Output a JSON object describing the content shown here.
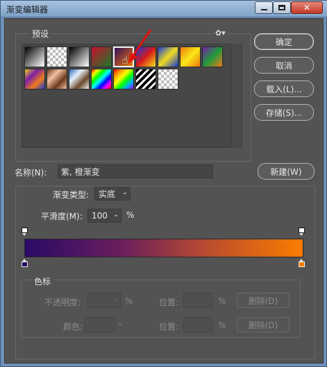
{
  "window": {
    "title": "渐变编辑器",
    "controls": {
      "minimize": "–",
      "maximize": "□",
      "close": "✕"
    }
  },
  "presets": {
    "label": "预设",
    "menu_icon": "gear-icon",
    "swatches_row1": [
      {
        "name": "foreground-to-background",
        "css": "linear-gradient(135deg,#000,#fff)"
      },
      {
        "name": "foreground-to-transparent",
        "css": "linear-gradient(135deg,#000 10%,rgba(0,0,0,0) 80%)"
      },
      {
        "name": "black-white",
        "css": "linear-gradient(135deg,#000,#fff)"
      },
      {
        "name": "red-green",
        "css": "linear-gradient(135deg,#c8102e,#1b7a2a)"
      },
      {
        "name": "violet-orange",
        "css": "linear-gradient(135deg,#2b0a63,#f97b00)"
      },
      {
        "name": "blue-red-yellow",
        "css": "linear-gradient(135deg,#1a3ad8,#d81a1a,#f2e21a)"
      },
      {
        "name": "blue-yellow-blue",
        "css": "linear-gradient(135deg,#1a3ad8,#f0dc20,#1a3ad8)"
      },
      {
        "name": "orange-yellow-orange",
        "css": "linear-gradient(135deg,#f0780a,#f8e81a,#f0780a)"
      },
      {
        "name": "violet-green-orange",
        "css": "linear-gradient(135deg,#7a1fa8,#1f9a3a,#f07a1a)"
      }
    ],
    "swatches_row2": [
      {
        "name": "yellow-violet-orange-blue",
        "css": "linear-gradient(135deg,#f2d21a,#7a1fa8,#f07a1a,#1a3ad8)"
      },
      {
        "name": "copper",
        "css": "linear-gradient(135deg,#6a3a1a,#f2c0a0,#6a3a1a,#f2c0a0)"
      },
      {
        "name": "chrome",
        "css": "linear-gradient(135deg,#2a6ab8,#e8f0ff,#6a4a2a,#f0f0f0)"
      },
      {
        "name": "spectrum",
        "css": "linear-gradient(135deg,#ff0000,#ffff00,#00ff00,#00ffff,#0000ff,#ff00ff,#ff0000)"
      },
      {
        "name": "transparent-rainbow",
        "css": "linear-gradient(135deg,#ff0000,#ff9900,#ffff00,#00ff00,#00aaff,#aa00ff)"
      },
      {
        "name": "transparent-stripes",
        "css": "repeating-linear-gradient(135deg,#000 0 4px,#fff 4px 7px)"
      },
      {
        "name": "transparent",
        "css": "checker"
      }
    ]
  },
  "buttons": {
    "ok": "确定",
    "cancel": "取消",
    "load": "载入(L)...",
    "save": "存储(S)...",
    "new": "新建(W)"
  },
  "name_field": {
    "label": "名称(N):",
    "value": "紫, 橙渐变"
  },
  "gradient": {
    "type_label": "渐变类型:",
    "type_value": "实底",
    "smoothness_label": "平滑度(M):",
    "smoothness_value": "100",
    "smoothness_unit": "%",
    "start_color": "#2a0a66",
    "end_color": "#fa7d00",
    "bar_css": "linear-gradient(90deg,#2a0a66 0%,#6a1f5c 35%,#b84a30 65%,#fa7d00 100%)"
  },
  "color_stops": {
    "label": "色标",
    "opacity_label": "不透明度:",
    "opacity_unit": "%",
    "position_label_1": "位置:",
    "position_unit_1": "%",
    "delete_label_1": "删除(D)",
    "color_label": "颜色:",
    "position_label_2": "位置:",
    "position_unit_2": "%",
    "delete_label_2": "删除(D)"
  }
}
